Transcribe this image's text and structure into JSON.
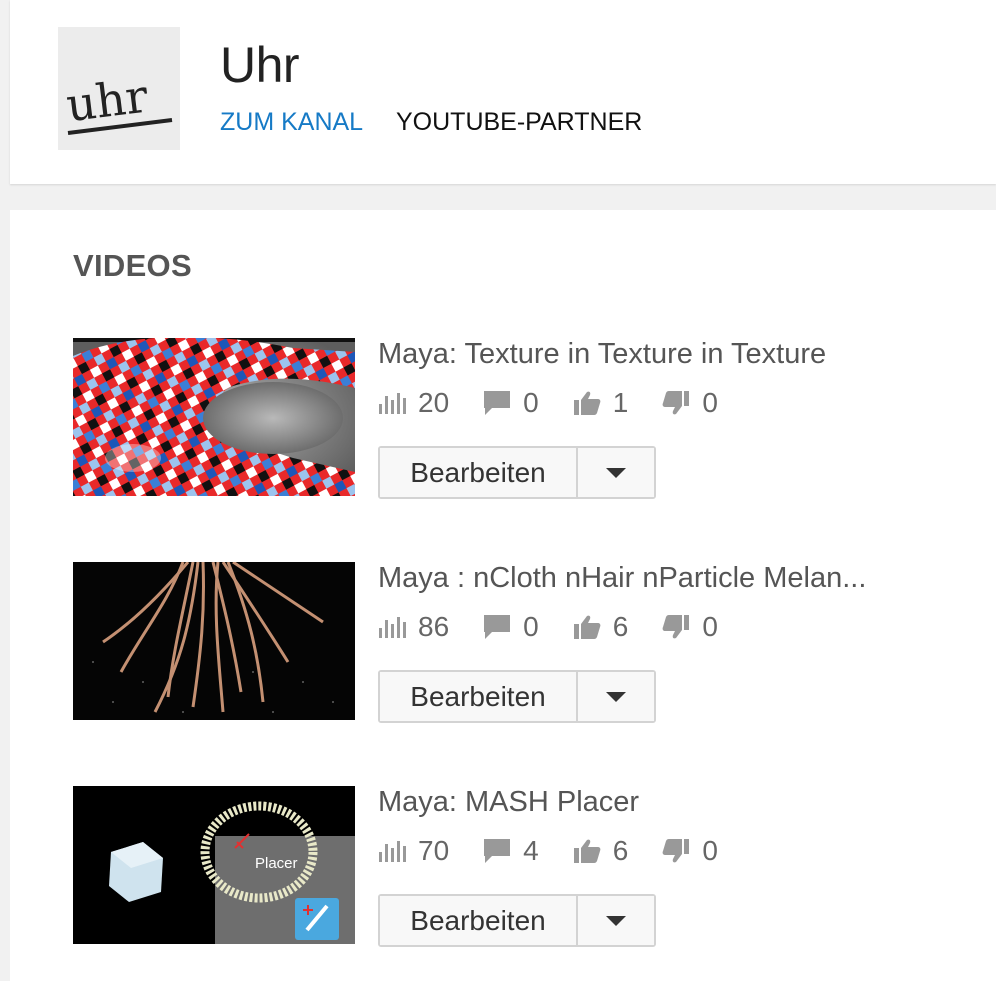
{
  "channel": {
    "logo_text": "uhr",
    "name": "Uhr",
    "link_label": "ZUM KANAL",
    "partner_label": "YOUTUBE-PARTNER",
    "link_color": "#167ac6"
  },
  "videos_section": {
    "title": "VIDEOS",
    "edit_label": "Bearbeiten",
    "items": [
      {
        "title": "Maya: Texture in Texture in Texture",
        "views": "20",
        "comments": "0",
        "likes": "1",
        "dislikes": "0"
      },
      {
        "title": "Maya : nCloth nHair nParticle Melan...",
        "views": "86",
        "comments": "0",
        "likes": "6",
        "dislikes": "0"
      },
      {
        "title": "Maya: MASH Placer",
        "views": "70",
        "comments": "4",
        "likes": "6",
        "dislikes": "0",
        "thumb_label": "Placer"
      }
    ]
  },
  "icons": {
    "views": "bar-chart-icon",
    "comments": "comment-icon",
    "likes": "thumbs-up-icon",
    "dislikes": "thumbs-down-icon",
    "dropdown": "caret-down-icon"
  }
}
